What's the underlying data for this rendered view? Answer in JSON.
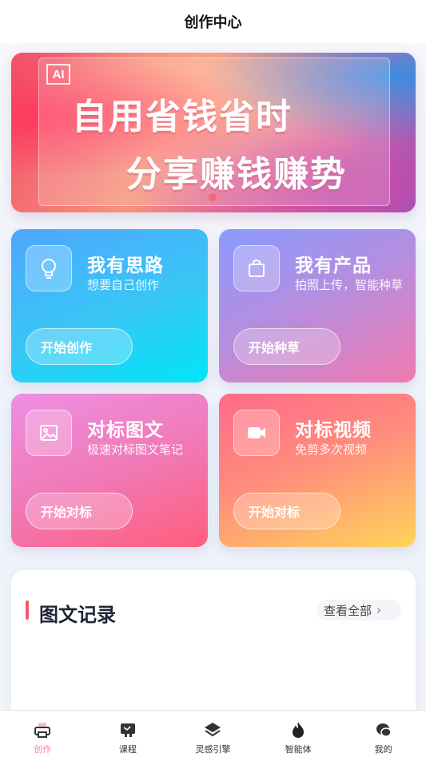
{
  "header": {
    "title": "创作中心"
  },
  "banner": {
    "badge": "AI",
    "line1": "自用省钱省时",
    "line2": "分享赚钱赚势"
  },
  "cards": [
    {
      "icon": "lightbulb-icon",
      "title": "我有思路",
      "subtitle": "想要自己创作",
      "button": "开始创作"
    },
    {
      "icon": "shopping-bag-icon",
      "title": "我有产品",
      "subtitle": "拍照上传，智能种草",
      "button": "开始种草"
    },
    {
      "icon": "image-icon",
      "title": "对标图文",
      "subtitle": "极速对标图文笔记",
      "button": "开始对标"
    },
    {
      "icon": "video-camera-icon",
      "title": "对标视频",
      "subtitle": "免剪多次视频",
      "button": "开始对标"
    }
  ],
  "records": {
    "title": "图文记录",
    "view_all": "查看全部"
  },
  "tabbar": {
    "active_index": 0,
    "active_color": "#f08a9a",
    "items": [
      {
        "label": "创作",
        "icon": "printer-icon"
      },
      {
        "label": "课程",
        "icon": "chalkboard-icon"
      },
      {
        "label": "灵感引擎",
        "icon": "layers-icon"
      },
      {
        "label": "智能体",
        "icon": "flame-icon"
      },
      {
        "label": "我的",
        "icon": "chat-bubbles-icon"
      }
    ]
  }
}
